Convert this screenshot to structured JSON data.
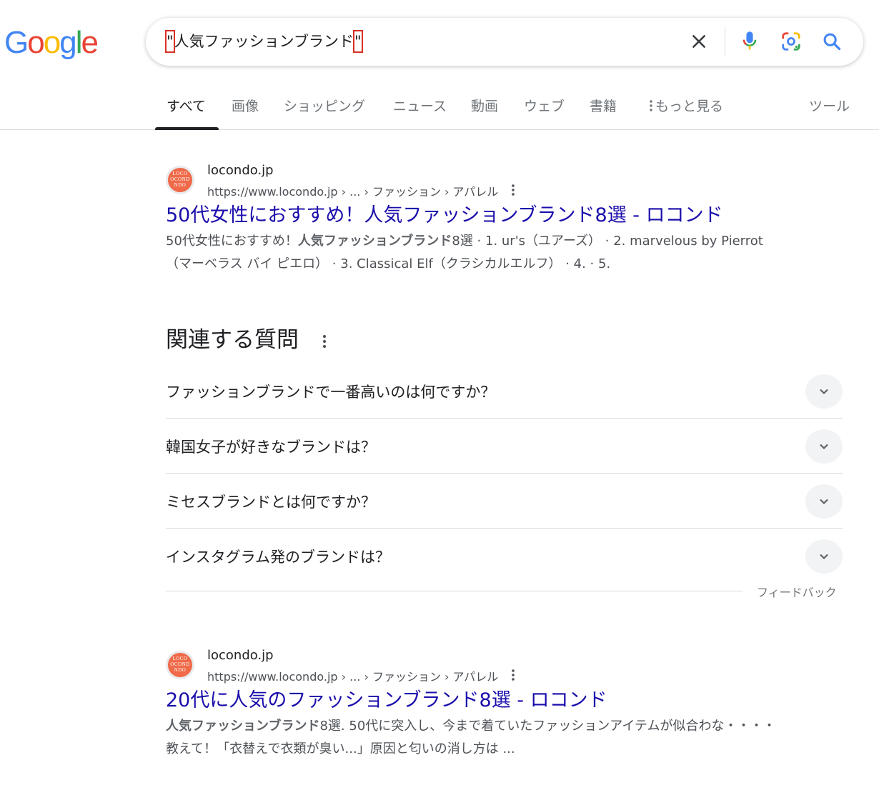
{
  "logo": {
    "text": "Google",
    "letters": [
      "G",
      "o",
      "o",
      "g",
      "l",
      "e"
    ],
    "colors": [
      "#4285F4",
      "#EA4335",
      "#FBBC05",
      "#4285F4",
      "#34A853",
      "#EA4335"
    ]
  },
  "search": {
    "query_open_quote": "\"",
    "query_text": "人気ファッションブランド",
    "query_close_quote": "\"",
    "icons": [
      "close-icon",
      "mic-icon",
      "lens-icon",
      "search-icon"
    ]
  },
  "tabs": [
    "すべて",
    "画像",
    "ショッピング",
    "ニュース",
    "動画",
    "ウェブ",
    "書籍",
    "もっと見る"
  ],
  "tools_label": "ツール",
  "results": [
    {
      "site": "locondo.jp",
      "url": "https://www.locondo.jp › ... › ファッション › アパレル",
      "favicon_text": [
        "LOCO",
        "OCOND",
        "NDO"
      ],
      "title": "50代女性におすすめ！人気ファッションブランド8選 - ロコンド",
      "snippet_pre": "50代女性におすすめ！",
      "snippet_bold": "人気ファッションブランド",
      "snippet_post": "8選 · 1. ur's（ユアーズ） · 2. marvelous by Pierrot（マーベラス バイ ピエロ） · 3. Classical Elf（クラシカルエルフ） · 4. · 5."
    },
    {
      "site": "locondo.jp",
      "url": "https://www.locondo.jp › ... › ファッション › アパレル",
      "favicon_text": [
        "LOCO",
        "OCOND",
        "NDO"
      ],
      "title": "20代に人気のファッションブランド8選 - ロコンド",
      "snippet_pre": "",
      "snippet_bold": "人気ファッションブランド",
      "snippet_post": "8選. 50代に突入し、今まで着ていたファッションアイテムが似合わな・・・・教えて！「衣替えで衣類が臭い...」原因と匂いの消し方は ..."
    }
  ],
  "paa": {
    "title": "関連する質問",
    "questions": [
      "ファッションブランドで一番高いのは何ですか？",
      "韓国女子が好きなブランドは？",
      "ミセスブランドとは何ですか？",
      "インスタグラム発のブランドは？"
    ],
    "feedback": "フィードバック"
  },
  "colors": {
    "link": "#1a0dab",
    "text": "#202124",
    "muted": "#4d5156",
    "accent_red": "#d93025"
  }
}
